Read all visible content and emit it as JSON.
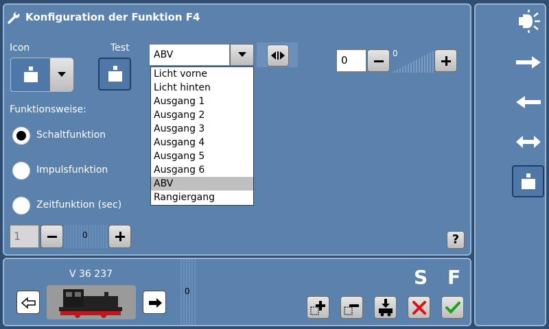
{
  "dialog": {
    "title": "Konfiguration der Funktion F4",
    "icon_label": "Icon",
    "test_label": "Test",
    "mode_label": "Funktionsweise:",
    "modes": [
      "Schaltfunktion",
      "Impulsfunktion",
      "Zeitfunktion (sec)"
    ],
    "selected_mode": 0,
    "time_value": "1",
    "time_slider_value": "0",
    "select_value": "ABV",
    "dropdown_options": [
      "Licht vorne",
      "Licht hinten",
      "Ausgang 1",
      "Ausgang 2",
      "Ausgang 3",
      "Ausgang 4",
      "Ausgang 5",
      "Ausgang 6",
      "ABV",
      "Rangiergang"
    ],
    "dropdown_selected_index": 8,
    "number_value": "0",
    "number_slider_value": "0",
    "help_label": "?"
  },
  "loco": {
    "name": "V 36 237",
    "speed_value": "0",
    "s_label": "S",
    "f_label": "F"
  },
  "icons": {
    "title": "wrench-icon",
    "function": "weight-icon",
    "sidebar": [
      "light-icon",
      "arrow-right-icon",
      "arrow-left-icon",
      "arrow-both-icon",
      "weight-icon"
    ]
  },
  "colors": {
    "panel": "#5b81ad",
    "background": "#2f4f72",
    "selected_button": "#1f3f66",
    "delete_red": "#e01010",
    "confirm_green": "#1aa31a"
  }
}
